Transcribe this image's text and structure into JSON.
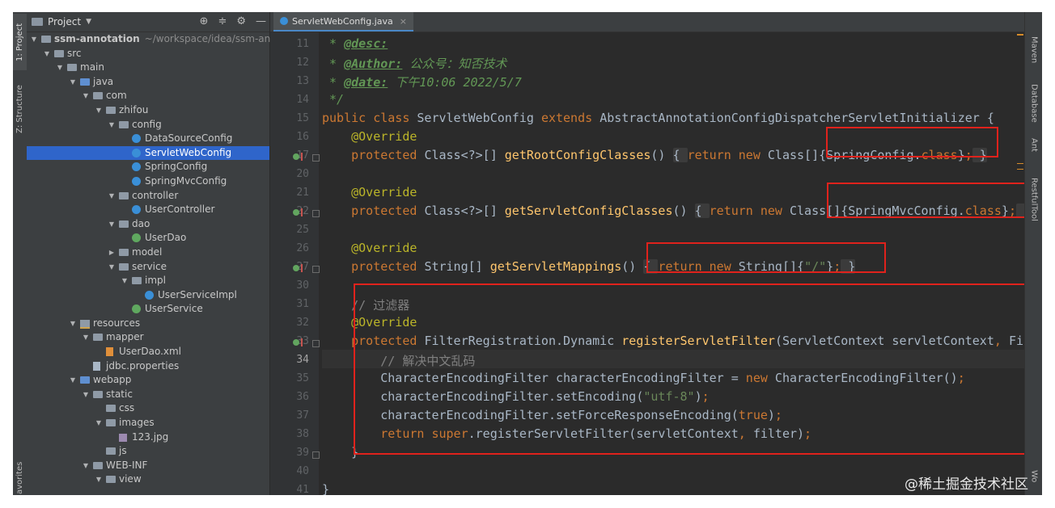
{
  "left_strip": {
    "project_label": "1: Project",
    "structure_label": "Z: Structure",
    "favorites_label": "avorites"
  },
  "project_panel": {
    "title": "Project",
    "tree": [
      {
        "label": "ssm-annotation",
        "extra": "~/workspace/idea/ssm-anno",
        "icon": "folder",
        "depth": 0,
        "open": true
      },
      {
        "label": "src",
        "icon": "folder",
        "depth": 1,
        "open": true
      },
      {
        "label": "main",
        "icon": "folder",
        "depth": 2,
        "open": true
      },
      {
        "label": "java",
        "icon": "folder-blue",
        "depth": 3,
        "open": true
      },
      {
        "label": "com",
        "icon": "folder",
        "depth": 4,
        "open": true
      },
      {
        "label": "zhifou",
        "icon": "folder",
        "depth": 5,
        "open": true
      },
      {
        "label": "config",
        "icon": "folder",
        "depth": 6,
        "open": true
      },
      {
        "label": "DataSourceConfig",
        "icon": "class",
        "depth": 7
      },
      {
        "label": "ServletWebConfig",
        "icon": "class",
        "depth": 7,
        "selected": true
      },
      {
        "label": "SpringConfig",
        "icon": "class",
        "depth": 7
      },
      {
        "label": "SpringMvcConfig",
        "icon": "class",
        "depth": 7
      },
      {
        "label": "controller",
        "icon": "folder",
        "depth": 6,
        "open": true
      },
      {
        "label": "UserController",
        "icon": "class",
        "depth": 7
      },
      {
        "label": "dao",
        "icon": "folder",
        "depth": 6,
        "open": true
      },
      {
        "label": "UserDao",
        "icon": "interface",
        "depth": 7
      },
      {
        "label": "model",
        "icon": "folder",
        "depth": 6,
        "open": false
      },
      {
        "label": "service",
        "icon": "folder",
        "depth": 6,
        "open": true
      },
      {
        "label": "impl",
        "icon": "folder",
        "depth": 7,
        "open": true
      },
      {
        "label": "UserServiceImpl",
        "icon": "class",
        "depth": 8
      },
      {
        "label": "UserService",
        "icon": "interface",
        "depth": 7
      },
      {
        "label": "resources",
        "icon": "resources",
        "depth": 3,
        "open": true
      },
      {
        "label": "mapper",
        "icon": "folder",
        "depth": 4,
        "open": true
      },
      {
        "label": "UserDao.xml",
        "icon": "xml",
        "depth": 5
      },
      {
        "label": "jdbc.properties",
        "icon": "file",
        "depth": 4
      },
      {
        "label": "webapp",
        "icon": "folder-blue",
        "depth": 3,
        "open": true
      },
      {
        "label": "static",
        "icon": "folder",
        "depth": 4,
        "open": true
      },
      {
        "label": "css",
        "icon": "folder",
        "depth": 5
      },
      {
        "label": "images",
        "icon": "folder",
        "depth": 5,
        "open": true
      },
      {
        "label": "123.jpg",
        "icon": "image",
        "depth": 6
      },
      {
        "label": "js",
        "icon": "folder",
        "depth": 5
      },
      {
        "label": "WEB-INF",
        "icon": "folder",
        "depth": 4,
        "open": true
      },
      {
        "label": "view",
        "icon": "folder",
        "depth": 5,
        "open": true
      }
    ]
  },
  "editor": {
    "tab_label": "ServletWebConfig.java",
    "current_line": "34",
    "lines": [
      {
        "n": "11",
        "tokens": [
          [
            "cmi",
            " * "
          ],
          [
            "tag",
            "@desc:"
          ]
        ]
      },
      {
        "n": "12",
        "tokens": [
          [
            "cmi",
            " * "
          ],
          [
            "tag",
            "@Author:"
          ],
          [
            "cmi",
            " 公众号：知否技术"
          ]
        ]
      },
      {
        "n": "13",
        "tokens": [
          [
            "cmi",
            " * "
          ],
          [
            "tag",
            "@date:"
          ],
          [
            "cmi",
            " 下午10:06 2022/5/7"
          ]
        ]
      },
      {
        "n": "14",
        "tokens": [
          [
            "cmi",
            " */"
          ]
        ]
      },
      {
        "n": "15",
        "tokens": [
          [
            "kw",
            "public class "
          ],
          [
            "tx",
            "ServletWebConfig "
          ],
          [
            "kw",
            "extends "
          ],
          [
            "tx",
            "AbstractAnnotationConfigDispatcherServletInitializer {"
          ]
        ]
      },
      {
        "n": "16",
        "tokens": [
          [
            "an",
            "    @Override"
          ]
        ]
      },
      {
        "n": "17",
        "tokens": [
          [
            "kw",
            "    protected "
          ],
          [
            "tx",
            "Class<?>[] "
          ],
          [
            "fn",
            "getRootConfigClasses"
          ],
          [
            "tx",
            "() "
          ],
          [
            "fb",
            "{ "
          ],
          [
            "kw",
            "return new "
          ],
          [
            "tx",
            "Class[]{SpringConfig."
          ],
          [
            "kw",
            "class"
          ],
          [
            "tx",
            "}"
          ],
          [
            "kw",
            ";"
          ],
          [
            "fb",
            " }"
          ]
        ]
      },
      {
        "n": "20",
        "tokens": []
      },
      {
        "n": "21",
        "tokens": [
          [
            "an",
            "    @Override"
          ]
        ]
      },
      {
        "n": "22",
        "tokens": [
          [
            "kw",
            "    protected "
          ],
          [
            "tx",
            "Class<?>[] "
          ],
          [
            "fn",
            "getServletConfigClasses"
          ],
          [
            "tx",
            "() "
          ],
          [
            "fb",
            "{ "
          ],
          [
            "kw",
            "return new "
          ],
          [
            "tx",
            "Class[]{SpringMvcConfig."
          ],
          [
            "kw",
            "class"
          ],
          [
            "tx",
            "}"
          ],
          [
            "kw",
            ";"
          ],
          [
            "fb",
            " }"
          ]
        ]
      },
      {
        "n": "25",
        "tokens": []
      },
      {
        "n": "26",
        "tokens": [
          [
            "an",
            "    @Override"
          ]
        ]
      },
      {
        "n": "27",
        "tokens": [
          [
            "kw",
            "    protected "
          ],
          [
            "tx",
            "String[] "
          ],
          [
            "fn",
            "getServletMappings"
          ],
          [
            "tx",
            "() "
          ],
          [
            "fb",
            "{ "
          ],
          [
            "kw",
            "return new "
          ],
          [
            "tx",
            "String[]{"
          ],
          [
            "st",
            "\"/\""
          ],
          [
            "tx",
            "}"
          ],
          [
            "kw",
            ";"
          ],
          [
            "fb",
            " }"
          ]
        ]
      },
      {
        "n": "30",
        "tokens": []
      },
      {
        "n": "31",
        "tokens": [
          [
            "cm",
            "    // 过滤器"
          ]
        ]
      },
      {
        "n": "32",
        "tokens": [
          [
            "an",
            "    @Override"
          ]
        ]
      },
      {
        "n": "33",
        "tokens": [
          [
            "kw",
            "    protected "
          ],
          [
            "tx",
            "FilterRegistration.Dynamic "
          ],
          [
            "fn",
            "registerServletFilter"
          ],
          [
            "tx",
            "(ServletContext servletContext"
          ],
          [
            "kw",
            ", "
          ],
          [
            "tx",
            "Filte"
          ]
        ]
      },
      {
        "n": "34",
        "tokens": [
          [
            "cm",
            "        // 解决中文乱码"
          ]
        ]
      },
      {
        "n": "35",
        "tokens": [
          [
            "tx",
            "        CharacterEncodingFilter characterEncodingFilter = "
          ],
          [
            "kw",
            "new "
          ],
          [
            "tx",
            "CharacterEncodingFilter()"
          ],
          [
            "kw",
            ";"
          ]
        ]
      },
      {
        "n": "36",
        "tokens": [
          [
            "tx",
            "        characterEncodingFilter.setEncoding("
          ],
          [
            "st",
            "\"utf-8\""
          ],
          [
            "tx",
            ")"
          ],
          [
            "kw",
            ";"
          ]
        ]
      },
      {
        "n": "37",
        "tokens": [
          [
            "tx",
            "        characterEncodingFilter.setForceResponseEncoding("
          ],
          [
            "kw",
            "true"
          ],
          [
            "tx",
            ")"
          ],
          [
            "kw",
            ";"
          ]
        ]
      },
      {
        "n": "38",
        "tokens": [
          [
            "kw",
            "        return super"
          ],
          [
            "tx",
            ".registerServletFilter(servletContext"
          ],
          [
            "kw",
            ", "
          ],
          [
            "tx",
            "filter)"
          ],
          [
            "kw",
            ";"
          ]
        ]
      },
      {
        "n": "39",
        "tokens": [
          [
            "tx",
            "    }"
          ]
        ]
      },
      {
        "n": "40",
        "tokens": []
      },
      {
        "n": "41",
        "tokens": [
          [
            "tx",
            "}"
          ]
        ]
      }
    ]
  },
  "right_strip": {
    "maven_label": "Maven",
    "database_label": "Database",
    "ant_label": "Ant",
    "restful_label": "RestfulTool",
    "wo_label": "Wo"
  },
  "watermark": "@稀土掘金技术社区",
  "colors": {
    "keyword": "#cc7832",
    "annotation": "#bbb529",
    "method": "#ffc66d",
    "string": "#6a8759",
    "comment": "#808080",
    "doc": "#629755",
    "highlight_box": "#e0221c",
    "selection": "#2f65ca"
  }
}
